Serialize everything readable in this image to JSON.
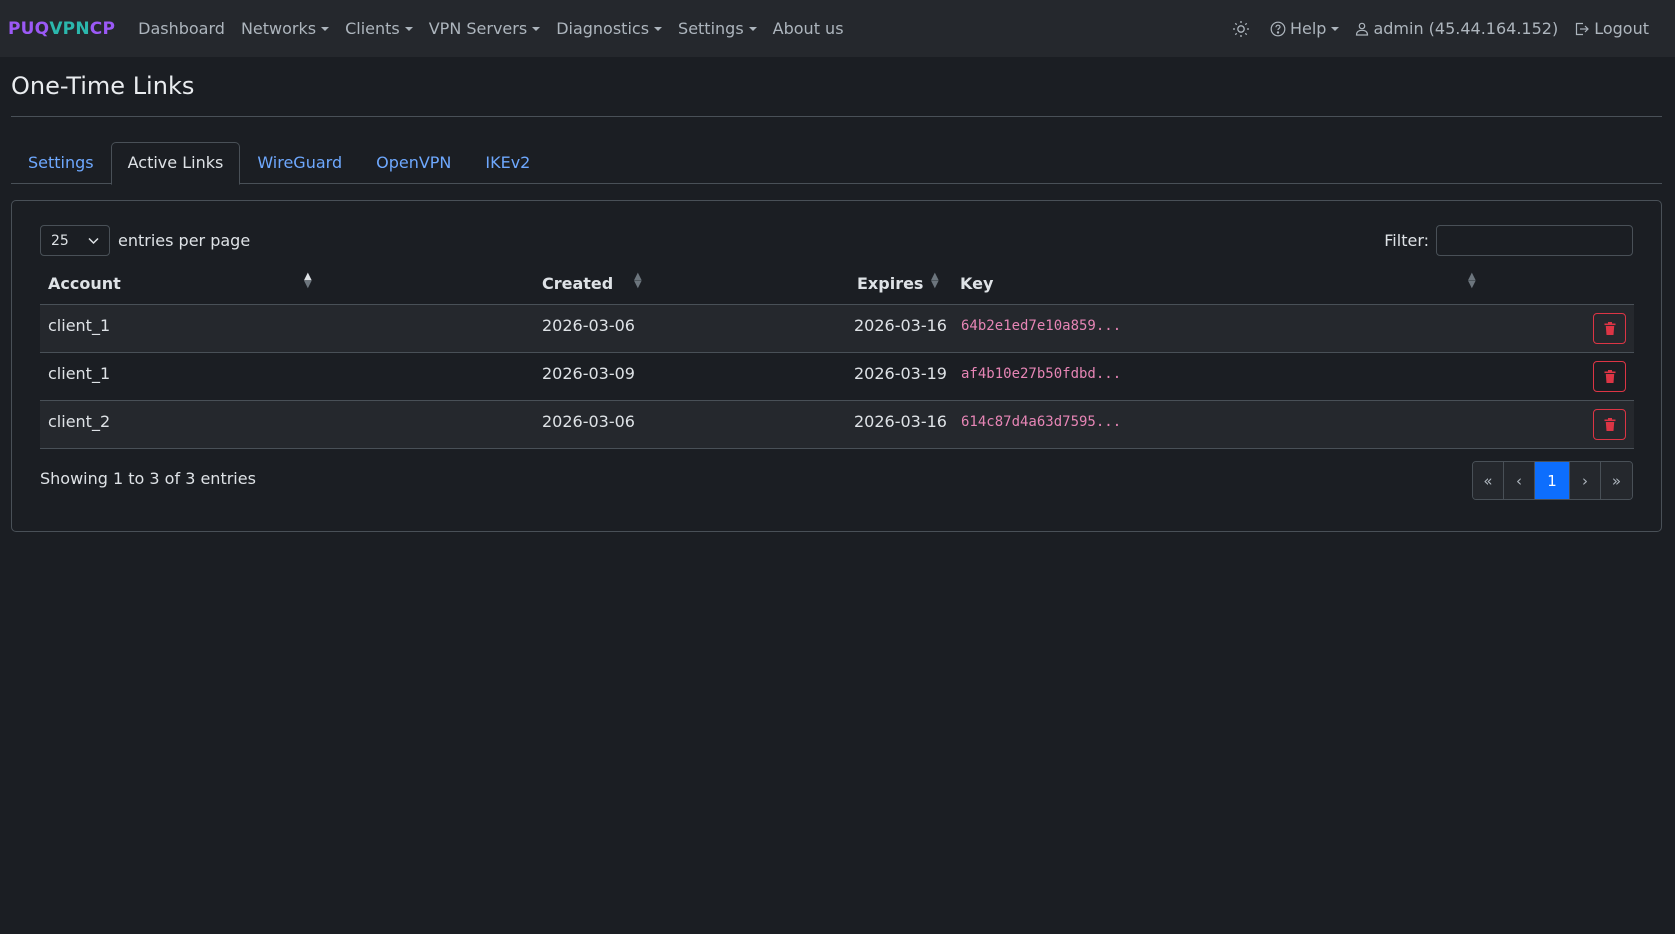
{
  "brand": {
    "part1": "PUQ",
    "part2": "VPN",
    "part3": "CP"
  },
  "nav": {
    "items": [
      {
        "label": "Dashboard",
        "dropdown": false
      },
      {
        "label": "Networks",
        "dropdown": true
      },
      {
        "label": "Clients",
        "dropdown": true
      },
      {
        "label": "VPN Servers",
        "dropdown": true
      },
      {
        "label": "Diagnostics",
        "dropdown": true
      },
      {
        "label": "Settings",
        "dropdown": true
      },
      {
        "label": "About us",
        "dropdown": false
      }
    ],
    "help_label": "Help",
    "user_label": "admin (45.44.164.152)",
    "logout_label": "Logout"
  },
  "page": {
    "title": "One-Time Links"
  },
  "tabs": [
    {
      "label": "Settings",
      "active": false
    },
    {
      "label": "Active Links",
      "active": true
    },
    {
      "label": "WireGuard",
      "active": false
    },
    {
      "label": "OpenVPN",
      "active": false
    },
    {
      "label": "IKEv2",
      "active": false
    }
  ],
  "table_controls": {
    "page_length": "25",
    "entries_label": "entries per page",
    "filter_label": "Filter:",
    "filter_value": ""
  },
  "table": {
    "columns": [
      "Account",
      "Created",
      "Expires",
      "Key"
    ],
    "rows": [
      {
        "account": "client_1",
        "created": "2026-03-06",
        "expires": "2026-03-16",
        "key": "64b2e1ed7e10a859..."
      },
      {
        "account": "client_1",
        "created": "2026-03-09",
        "expires": "2026-03-19",
        "key": "af4b10e27b50fdbd..."
      },
      {
        "account": "client_2",
        "created": "2026-03-06",
        "expires": "2026-03-16",
        "key": "614c87d4a63d7595..."
      }
    ]
  },
  "footer": {
    "info": "Showing 1 to 3 of 3 entries",
    "pager": {
      "first": "«",
      "prev": "‹",
      "current": "1",
      "next": "›",
      "last": "»"
    }
  },
  "colors": {
    "accent": "#0d6efd",
    "danger": "#dc3545",
    "key_text": "#e685b5",
    "brand_purple": "#9b59f6",
    "brand_teal": "#2bb8ad"
  },
  "icons": {
    "theme": "sun-icon",
    "help": "question-circle-icon",
    "user": "person-icon",
    "logout": "logout-icon",
    "delete": "trash-icon"
  }
}
